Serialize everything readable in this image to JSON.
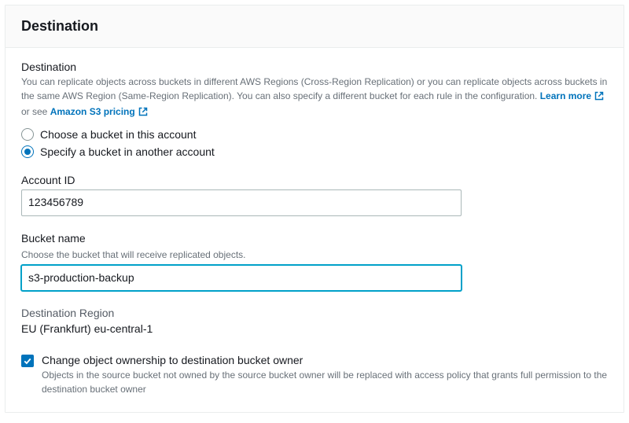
{
  "panel": {
    "title": "Destination"
  },
  "intro": {
    "heading": "Destination",
    "description_pre": "You can replicate objects across buckets in different AWS Regions (Cross-Region Replication) or you can replicate objects across buckets in the same AWS Region (Same-Region Replication). You can also specify a different bucket for each rule in the configuration. ",
    "learn_more": "Learn more",
    "or_see_pre": "or see ",
    "s3_pricing": "Amazon S3 pricing"
  },
  "radio": {
    "option_same": "Choose a bucket in this account",
    "option_other": "Specify a bucket in another account"
  },
  "account_id": {
    "label": "Account ID",
    "value": "123456789"
  },
  "bucket_name": {
    "label": "Bucket name",
    "help": "Choose the bucket that will receive replicated objects.",
    "value": "s3-production-backup"
  },
  "dest_region": {
    "label": "Destination Region",
    "value": "EU (Frankfurt) eu-central-1"
  },
  "ownership": {
    "label": "Change object ownership to destination bucket owner",
    "help": "Objects in the source bucket not owned by the source bucket owner will be replaced with access policy that grants full permission to the destination bucket owner"
  }
}
